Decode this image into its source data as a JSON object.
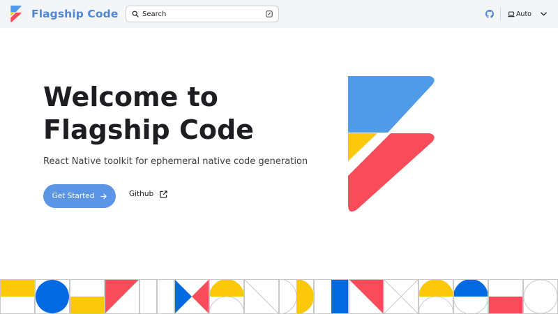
{
  "navbar": {
    "brand_title": "Flagship Code",
    "search": {
      "label": "Search"
    },
    "color_mode": {
      "label": "Auto"
    }
  },
  "hero": {
    "title_line1": "Welcome to",
    "title_line2": "Flagship Code",
    "subtitle": "React Native toolkit for ephemeral native code generation",
    "primary_cta": "Get Started",
    "secondary_cta": "Github"
  },
  "colors": {
    "brand_blue": "#4f86d6",
    "logo_blue": "#4f9be8",
    "logo_yellow": "#fcc809",
    "logo_red": "#f94c5a",
    "button_blue": "#5b95e6",
    "pattern_blue": "#0369e1"
  },
  "icons": [
    "brand-logo",
    "search-icon",
    "keyboard-shortcut-icon",
    "github-icon",
    "laptop-icon",
    "chevron-down-icon",
    "arrow-right-icon",
    "external-link-icon"
  ]
}
